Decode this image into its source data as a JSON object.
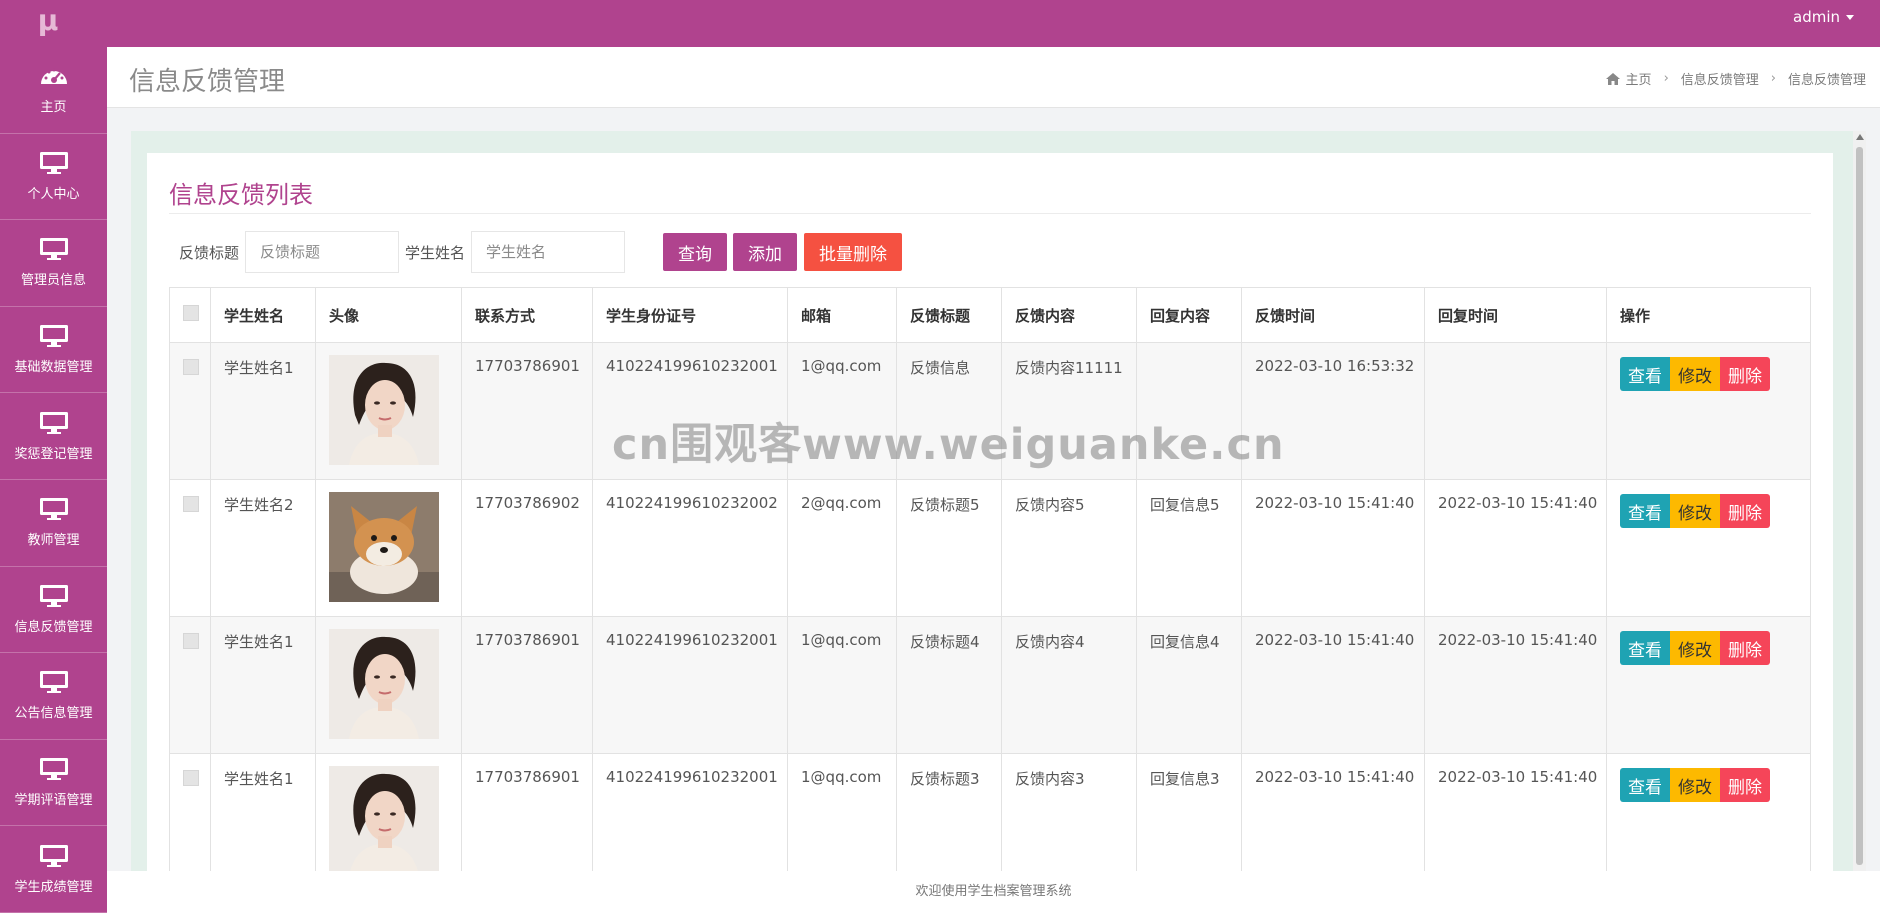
{
  "header": {
    "logo_text": "μ",
    "user": "admin"
  },
  "sidebar": {
    "items": [
      {
        "label": "主页",
        "icon": "dashboard-icon"
      },
      {
        "label": "个人中心",
        "icon": "monitor-icon"
      },
      {
        "label": "管理员信息",
        "icon": "monitor-icon"
      },
      {
        "label": "基础数据管理",
        "icon": "monitor-icon"
      },
      {
        "label": "奖惩登记管理",
        "icon": "monitor-icon"
      },
      {
        "label": "教师管理",
        "icon": "monitor-icon"
      },
      {
        "label": "信息反馈管理",
        "icon": "monitor-icon"
      },
      {
        "label": "公告信息管理",
        "icon": "monitor-icon"
      },
      {
        "label": "学期评语管理",
        "icon": "monitor-icon"
      },
      {
        "label": "学生成绩管理",
        "icon": "monitor-icon"
      }
    ]
  },
  "page": {
    "title": "信息反馈管理",
    "breadcrumb": [
      "主页",
      "信息反馈管理",
      "信息反馈管理"
    ]
  },
  "panel": {
    "title": "信息反馈列表"
  },
  "search": {
    "title_label": "反馈标题",
    "title_placeholder": "反馈标题",
    "name_label": "学生姓名",
    "name_placeholder": "学生姓名",
    "query_btn": "查询",
    "add_btn": "添加",
    "batch_delete_btn": "批量删除"
  },
  "table": {
    "headers": [
      "学生姓名",
      "头像",
      "联系方式",
      "学生身份证号",
      "邮箱",
      "反馈标题",
      "反馈内容",
      "回复内容",
      "反馈时间",
      "回复时间",
      "操作"
    ],
    "rows": [
      {
        "name": "学生姓名1",
        "avatar": "woman-portrait",
        "phone": "17703786901",
        "idcard": "410224199610232001",
        "email": "1@qq.com",
        "title": "反馈信息",
        "content": "反馈内容11111",
        "reply": "",
        "time": "2022-03-10 16:53:32",
        "reply_time": ""
      },
      {
        "name": "学生姓名2",
        "avatar": "shiba-dog",
        "phone": "17703786902",
        "idcard": "410224199610232002",
        "email": "2@qq.com",
        "title": "反馈标题5",
        "content": "反馈内容5",
        "reply": "回复信息5",
        "time": "2022-03-10 15:41:40",
        "reply_time": "2022-03-10 15:41:40"
      },
      {
        "name": "学生姓名1",
        "avatar": "woman-portrait",
        "phone": "17703786901",
        "idcard": "410224199610232001",
        "email": "1@qq.com",
        "title": "反馈标题4",
        "content": "反馈内容4",
        "reply": "回复信息4",
        "time": "2022-03-10 15:41:40",
        "reply_time": "2022-03-10 15:41:40"
      },
      {
        "name": "学生姓名1",
        "avatar": "woman-portrait",
        "phone": "17703786901",
        "idcard": "410224199610232001",
        "email": "1@qq.com",
        "title": "反馈标题3",
        "content": "反馈内容3",
        "reply": "回复信息3",
        "time": "2022-03-10 15:41:40",
        "reply_time": "2022-03-10 15:41:40"
      }
    ],
    "actions": {
      "view": "查看",
      "edit": "修改",
      "delete": "删除"
    }
  },
  "footer": {
    "text": "欢迎使用学生档案管理系统"
  },
  "watermark": {
    "text": "cn围观客www.weiguanke.cn"
  },
  "colors": {
    "brand": "#b0438e",
    "danger": "#f55141",
    "info": "#1fa3b3",
    "warning": "#fdb900",
    "delete": "#f54559"
  }
}
